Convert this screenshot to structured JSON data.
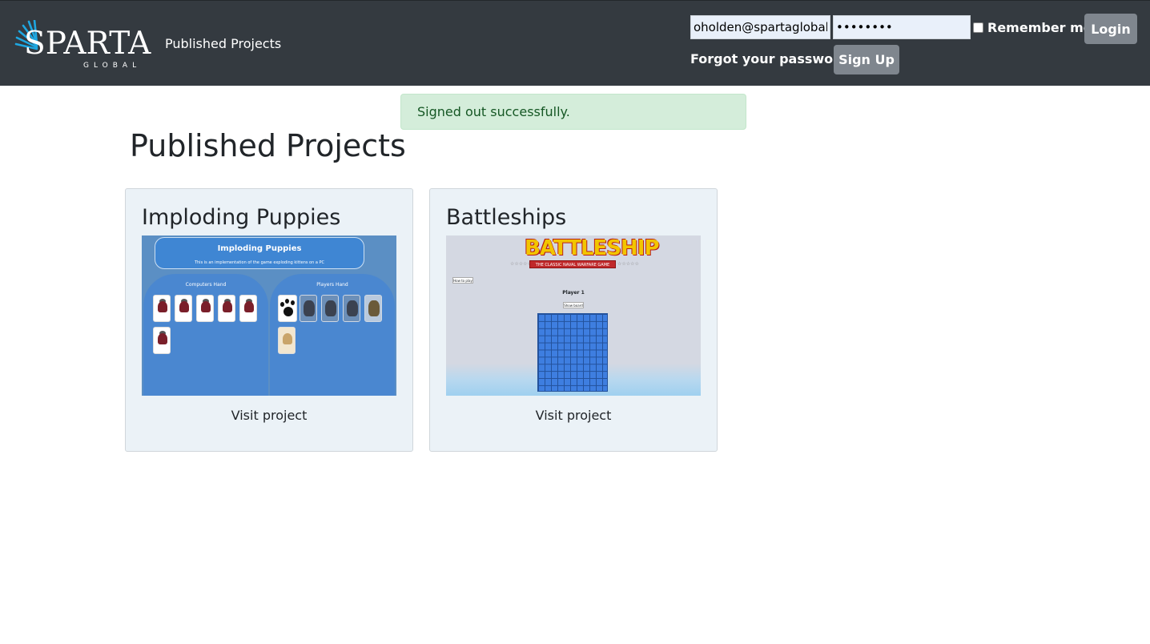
{
  "brand": {
    "name": "SPARTA",
    "sub": "GLOBAL"
  },
  "nav": {
    "published_projects_link": "Published Projects"
  },
  "login": {
    "email_value": "oholden@spartaglobal",
    "password_value": "••••••••",
    "remember_label": "Remember me",
    "login_label": "Login",
    "forgot_label": "Forgot your password?",
    "signup_label": "Sign Up"
  },
  "alert": {
    "message": "Signed out successfully."
  },
  "page": {
    "title": "Published Projects"
  },
  "projects": [
    {
      "title": "Imploding Puppies",
      "link_label": "Visit project",
      "thumb": {
        "header_title": "Imploding Puppies",
        "header_sub": "This is an implementation of the game exploding kittens on a PC",
        "left_label": "Computers Hand",
        "right_label": "Players Hand"
      }
    },
    {
      "title": "Battleships",
      "link_label": "Visit project",
      "thumb": {
        "logo": "BATTLESHIP",
        "banner": "THE CLASSIC NAVAL WARFARE GAME",
        "howto": "How to play",
        "player": "Player 1",
        "showboard": "Show board"
      }
    }
  ],
  "colors": {
    "navbar": "#343a40",
    "alert_bg": "#d4edda",
    "alert_text": "#155724",
    "button_gray": "#7f868e",
    "card_bg": "#ebf2f7"
  }
}
